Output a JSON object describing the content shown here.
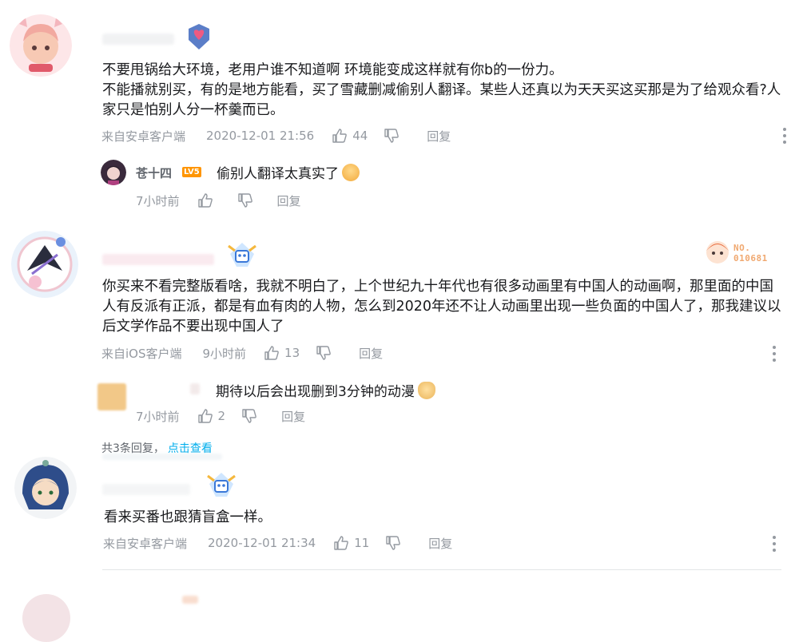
{
  "comments": [
    {
      "text": "不要甩锅给大环境，老用户谁不知道啊 环境能变成这样就有你b的一份力。\n不能播就别买，有的是地方能看，买了雪藏删减偷别人翻译。某些人还真以为天天买这买那是为了给观众看?人家只是怕别人分一杯羹而已。",
      "source": "来自安卓客户端",
      "time": "2020-12-01 21:56",
      "likes": "44",
      "reply_label": "回复"
    },
    {
      "text": "你买来不看完整版看啥，我就不明白了，上个世纪九十年代也有很多动画里有中国人的动画啊，那里面的中国人有反派有正派，都是有血有肉的人物，怎么到2020年还不让人动画里出现一些负面的中国人了，那我建议以后文学作品不要出现中国人了",
      "source": "来自iOS客户端",
      "time": "9小时前",
      "likes": "13",
      "reply_label": "回复",
      "fan_badge": "NO.\n010681"
    },
    {
      "text": "看来买番也跟猜盲盒一样。",
      "source": "来自安卓客户端",
      "time": "2020-12-01 21:34",
      "likes": "11",
      "reply_label": "回复"
    }
  ],
  "replies": [
    {
      "name": "苍十四",
      "level": "LV5",
      "text": "偷别人翻译太真实了",
      "time": "7小时前",
      "likes": "",
      "reply_label": "回复"
    },
    {
      "name": "",
      "text": "期待以后会出现删到3分钟的动漫",
      "time": "7小时前",
      "likes": "2",
      "reply_label": "回复"
    }
  ],
  "more_replies": {
    "count_text": "共3条回复，",
    "link_text": "点击查看"
  },
  "colors": {
    "text": "#18191c",
    "meta": "#9499a0",
    "link": "#00aeec",
    "level": "#ff9500"
  }
}
